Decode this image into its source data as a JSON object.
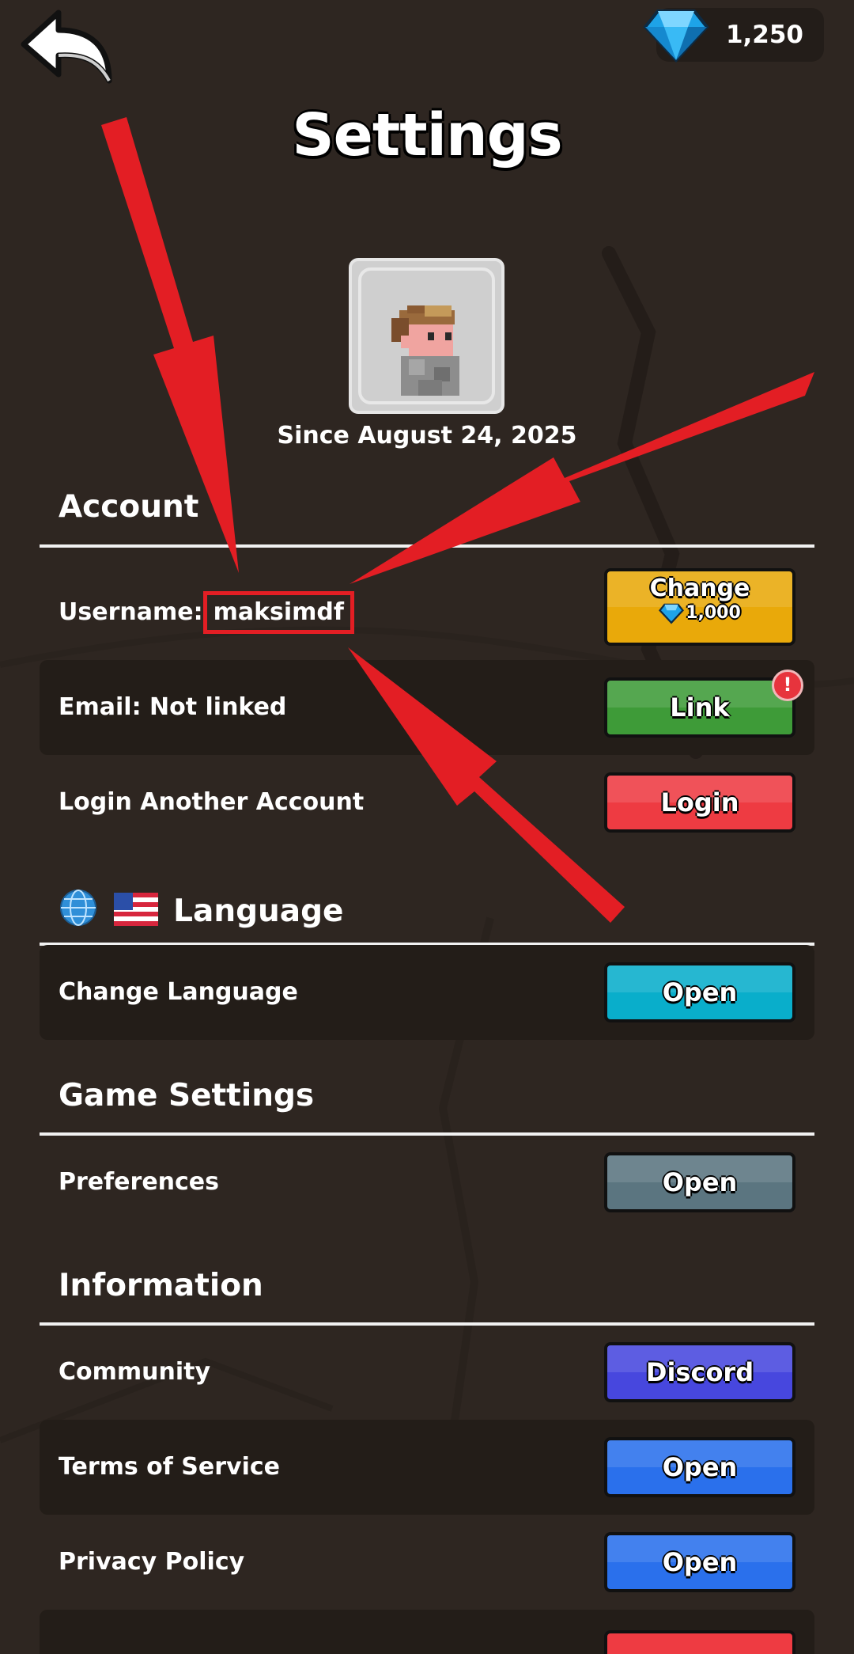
{
  "header": {
    "gem_count": "1,250",
    "title": "Settings"
  },
  "profile": {
    "since": "Since August 24, 2025"
  },
  "account": {
    "title": "Account",
    "username_label": "Username:",
    "username_value": "maksimdf",
    "change_label": "Change",
    "change_cost": "1,000",
    "email_label": "Email: Not linked",
    "link_label": "Link",
    "login_another_label": "Login Another Account",
    "login_label": "Login"
  },
  "language": {
    "title": "Language",
    "change_language_label": "Change Language",
    "open_label": "Open"
  },
  "game_settings": {
    "title": "Game Settings",
    "preferences_label": "Preferences",
    "open_label": "Open"
  },
  "information": {
    "title": "Information",
    "community_label": "Community",
    "discord_label": "Discord",
    "terms_label": "Terms of Service",
    "terms_open_label": "Open",
    "privacy_label": "Privacy Policy",
    "privacy_open_label": "Open"
  },
  "colors": {
    "background": "#2e2621",
    "annotation_red": "#e31e24",
    "gem_blue": "#29b6f6"
  }
}
